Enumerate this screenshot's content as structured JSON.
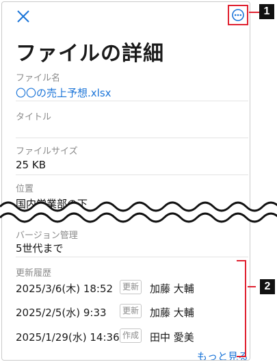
{
  "header": {
    "close_icon": "close-icon",
    "more_icon": "more-options-icon",
    "accent": "#1a74d8",
    "highlight": "#e0202f"
  },
  "page_title": "ファイルの詳細",
  "fields": {
    "file_name": {
      "label": "ファイル名",
      "value": "〇〇の売上予想.xlsx"
    },
    "title": {
      "label": "タイトル",
      "value": ""
    },
    "file_size": {
      "label": "ファイルサイズ",
      "value": "25 KB"
    },
    "location": {
      "label": "位置",
      "value": "国内営業部の下"
    },
    "version": {
      "label": "バージョン管理",
      "value": "5世代まで"
    }
  },
  "history": {
    "label": "更新履歴",
    "rows": [
      {
        "date": "2025/3/6(木) 18:52",
        "action": "更新",
        "user": "加藤 大輔"
      },
      {
        "date": "2025/2/5(水) 9:33",
        "action": "更新",
        "user": "加藤 大輔"
      },
      {
        "date": "2025/1/29(水) 14:36",
        "action": "作成",
        "user": "田中 愛美"
      }
    ],
    "more_label": "もっと見る"
  },
  "callouts": {
    "one": "1",
    "two": "2"
  }
}
